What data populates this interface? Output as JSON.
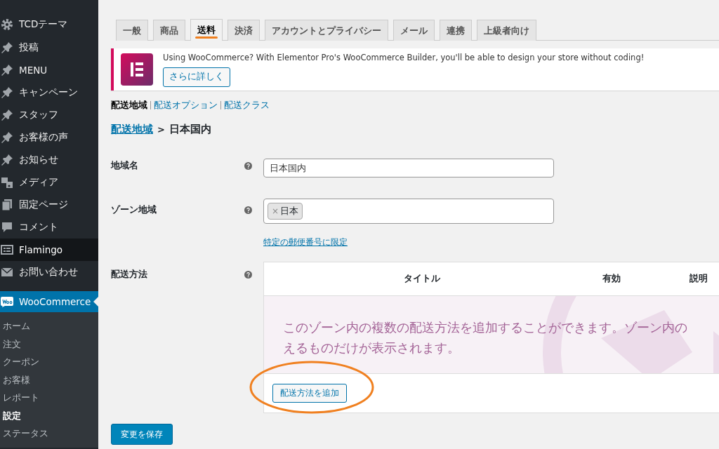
{
  "sidebar": {
    "items": [
      {
        "label": "TCDテーマ",
        "kind": "gear",
        "selected": false,
        "highlighted": false
      },
      {
        "label": "投稿",
        "kind": "pin",
        "selected": false,
        "highlighted": false
      },
      {
        "label": "MENU",
        "kind": "pin",
        "selected": false,
        "highlighted": false
      },
      {
        "label": "キャンペーン",
        "kind": "pin",
        "selected": false,
        "highlighted": false
      },
      {
        "label": "スタッフ",
        "kind": "pin",
        "selected": false,
        "highlighted": false
      },
      {
        "label": "お客様の声",
        "kind": "pin",
        "selected": false,
        "highlighted": false
      },
      {
        "label": "お知らせ",
        "kind": "pin",
        "selected": false,
        "highlighted": false
      },
      {
        "label": "メディア",
        "kind": "media",
        "selected": false,
        "highlighted": false
      },
      {
        "label": "固定ページ",
        "kind": "pages",
        "selected": false,
        "highlighted": false
      },
      {
        "label": "コメント",
        "kind": "comment",
        "selected": false,
        "highlighted": false
      },
      {
        "label": "Flamingo",
        "kind": "list",
        "selected": false,
        "highlighted": true
      },
      {
        "label": "お問い合わせ",
        "kind": "mail",
        "selected": false,
        "highlighted": false
      },
      {
        "label": "WooCommerce",
        "kind": "woo",
        "selected": true,
        "highlighted": false
      }
    ],
    "submenu": [
      {
        "label": "ホーム",
        "selected": false
      },
      {
        "label": "注文",
        "selected": false
      },
      {
        "label": "クーポン",
        "selected": false
      },
      {
        "label": "お客様",
        "selected": false
      },
      {
        "label": "レポート",
        "selected": false
      },
      {
        "label": "設定",
        "selected": true
      },
      {
        "label": "ステータス",
        "selected": false
      }
    ]
  },
  "tabs": [
    {
      "label": "一般",
      "selected": false,
      "marked": false
    },
    {
      "label": "商品",
      "selected": false,
      "marked": false
    },
    {
      "label": "送料",
      "selected": true,
      "marked": true
    },
    {
      "label": "決済",
      "selected": false,
      "marked": false
    },
    {
      "label": "アカウントとプライバシー",
      "selected": false,
      "marked": false
    },
    {
      "label": "メール",
      "selected": false,
      "marked": false
    },
    {
      "label": "連携",
      "selected": false,
      "marked": false
    },
    {
      "label": "上級者向け",
      "selected": false,
      "marked": false
    }
  ],
  "notice": {
    "message": "Using WooCommerce? With Elementor Pro's WooCommerce Builder, you'll be able to design your store without coding!",
    "button": "さらに詳しく"
  },
  "subnav": [
    {
      "label": "配送地域",
      "selected": true
    },
    {
      "label": "配送オプション",
      "selected": false
    },
    {
      "label": "配送クラス",
      "selected": false
    }
  ],
  "breadcrumb": {
    "link": "配送地域",
    "separator": ">",
    "current": "日本国内"
  },
  "form": {
    "zone_name": {
      "label": "地域名",
      "value": "日本国内"
    },
    "zone_regions": {
      "label": "ゾーン地域",
      "tags": [
        {
          "remove": "×",
          "label": "日本"
        }
      ],
      "link": "特定の郵便番号に限定"
    },
    "shipping_methods": {
      "label": "配送方法",
      "columns": [
        "タイトル",
        "有効",
        "説明"
      ],
      "empty_message_lines": [
        "このゾーン内の複数の配送方法を追加することができます。ゾーン内の",
        "えるものだけが表示されます。"
      ],
      "add_button": {
        "label": "配送方法を追加",
        "circled": true
      }
    }
  },
  "save_button": "変更を保存"
}
